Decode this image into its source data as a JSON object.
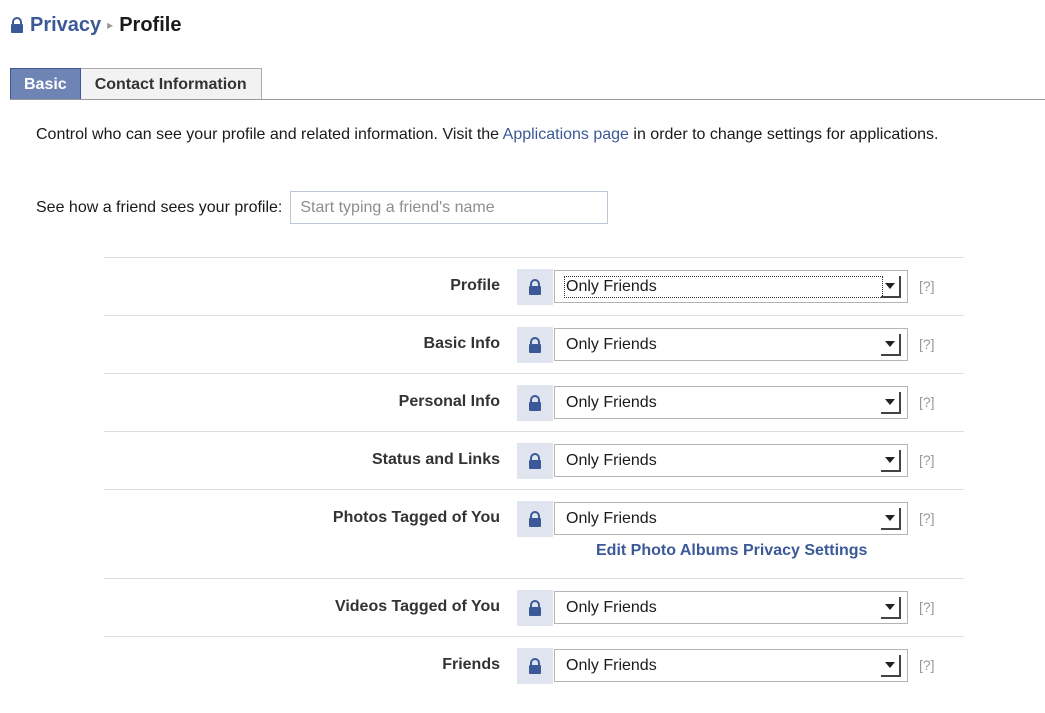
{
  "breadcrumb": {
    "parent": "Privacy",
    "separator": "▸",
    "current": "Profile"
  },
  "tabs": [
    {
      "label": "Basic",
      "active": true
    },
    {
      "label": "Contact Information",
      "active": false
    }
  ],
  "intro": {
    "text_before": "Control who can see your profile and related information. Visit the ",
    "link": "Applications page",
    "text_after": " in order to change settings for applications."
  },
  "preview": {
    "label": "See how a friend sees your profile:",
    "placeholder": "Start typing a friend's name"
  },
  "settings": [
    {
      "label": "Profile",
      "value": "Only Friends",
      "help": "[?]"
    },
    {
      "label": "Basic Info",
      "value": "Only Friends",
      "help": "[?]"
    },
    {
      "label": "Personal Info",
      "value": "Only Friends",
      "help": "[?]"
    },
    {
      "label": "Status and Links",
      "value": "Only Friends",
      "help": "[?]"
    },
    {
      "label": "Photos Tagged of You",
      "value": "Only Friends",
      "help": "[?]",
      "sub_link": "Edit Photo Albums Privacy Settings"
    },
    {
      "label": "Videos Tagged of You",
      "value": "Only Friends",
      "help": "[?]"
    },
    {
      "label": "Friends",
      "value": "Only Friends",
      "help": "[?]"
    }
  ],
  "icons": {
    "lock": "lock-icon",
    "dropdown": "chevron-down-icon"
  },
  "colors": {
    "brand_blue": "#3b5998",
    "tab_active_bg": "#6d84b4",
    "lock_bg": "#dfe4ee"
  }
}
